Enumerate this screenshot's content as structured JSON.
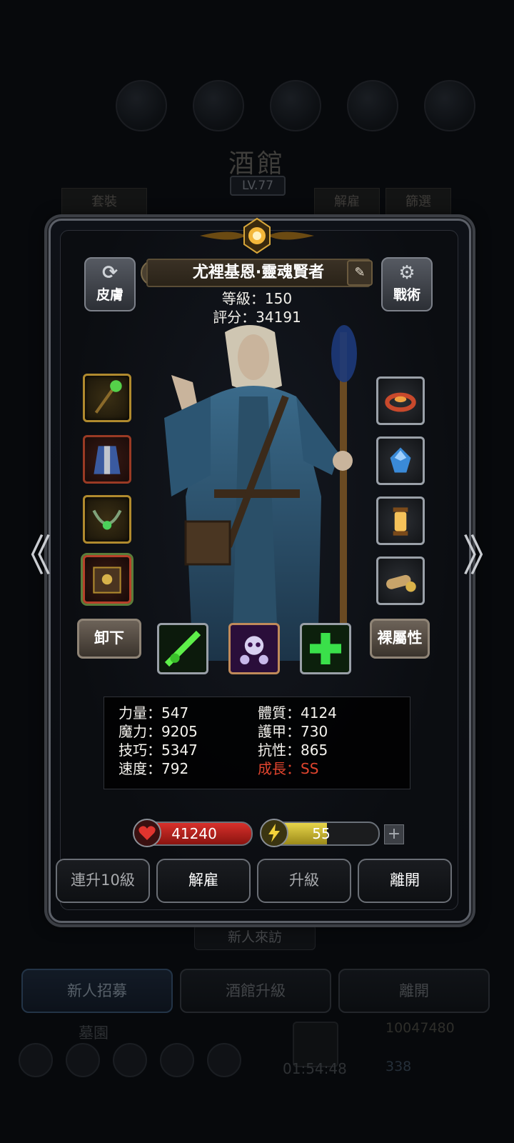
{
  "background": {
    "title": "酒館",
    "level": "LV.77",
    "tab_set": "套裝",
    "tab_dismiss": "解雇",
    "tab_filter": "篩選",
    "new_visit": "新人來訪",
    "buttons": [
      "新人招募",
      "酒館升級",
      "離開"
    ],
    "bottom_label": "墓園",
    "gold": "10047480",
    "gems": "338",
    "timer": "01:54:48"
  },
  "hero": {
    "name": "尤裡基恩·靈魂賢者",
    "level": "等級：150",
    "score": "評分：34191",
    "skin_label": "皮膚",
    "tactics_label": "戰術"
  },
  "actions": {
    "unequip": "卸下",
    "base_attr": "裸屬性"
  },
  "stats": {
    "strength": "力量：547",
    "magic": "魔力：9205",
    "skill": "技巧：5347",
    "speed": "速度：792",
    "constitution": "體質：4124",
    "armor": "護甲：730",
    "resistance": "抗性：865",
    "growth": "成長：SS"
  },
  "bars": {
    "hp": "41240",
    "energy": "55",
    "energy_fraction": 0.55,
    "plus": "+"
  },
  "panel_buttons": {
    "level_up_10": "連升10級",
    "dismiss": "解雇",
    "upgrade": "升級",
    "leave": "離開"
  },
  "nav": {
    "left": "《",
    "right": "》"
  },
  "colors": {
    "growth": "#e0442e",
    "hp": "#d8302b",
    "energy": "#e7d54a"
  }
}
